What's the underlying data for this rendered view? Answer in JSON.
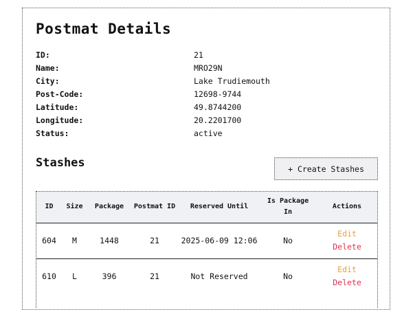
{
  "header": {
    "title": "Postmat Details"
  },
  "details": [
    {
      "label": "ID:",
      "value": "21"
    },
    {
      "label": "Name:",
      "value": "MRO29N"
    },
    {
      "label": "City:",
      "value": "Lake Trudiemouth"
    },
    {
      "label": "Post-Code:",
      "value": "12698-9744"
    },
    {
      "label": "Latitude:",
      "value": "49.8744200"
    },
    {
      "label": "Longitude:",
      "value": "20.2201700"
    },
    {
      "label": "Status:",
      "value": "active"
    }
  ],
  "stashes": {
    "title": "Stashes",
    "create_label": "+ Create Stashes",
    "columns": [
      "ID",
      "Size",
      "Package",
      "Postmat ID",
      "Reserved Until",
      "Is Package In",
      "Actions"
    ],
    "rows": [
      {
        "id": "604",
        "size": "M",
        "package": "1448",
        "postmat_id": "21",
        "reserved_until": "2025-06-09 12:06",
        "package_in": "No",
        "edit": "Edit",
        "delete": "Delete"
      },
      {
        "id": "610",
        "size": "L",
        "package": "396",
        "postmat_id": "21",
        "reserved_until": "Not Reserved",
        "package_in": "No",
        "edit": "Edit",
        "delete": "Delete"
      }
    ]
  },
  "colors": {
    "edit": "#e8a13a",
    "delete": "#e0304a",
    "header_bg": "#f0f1f4"
  }
}
